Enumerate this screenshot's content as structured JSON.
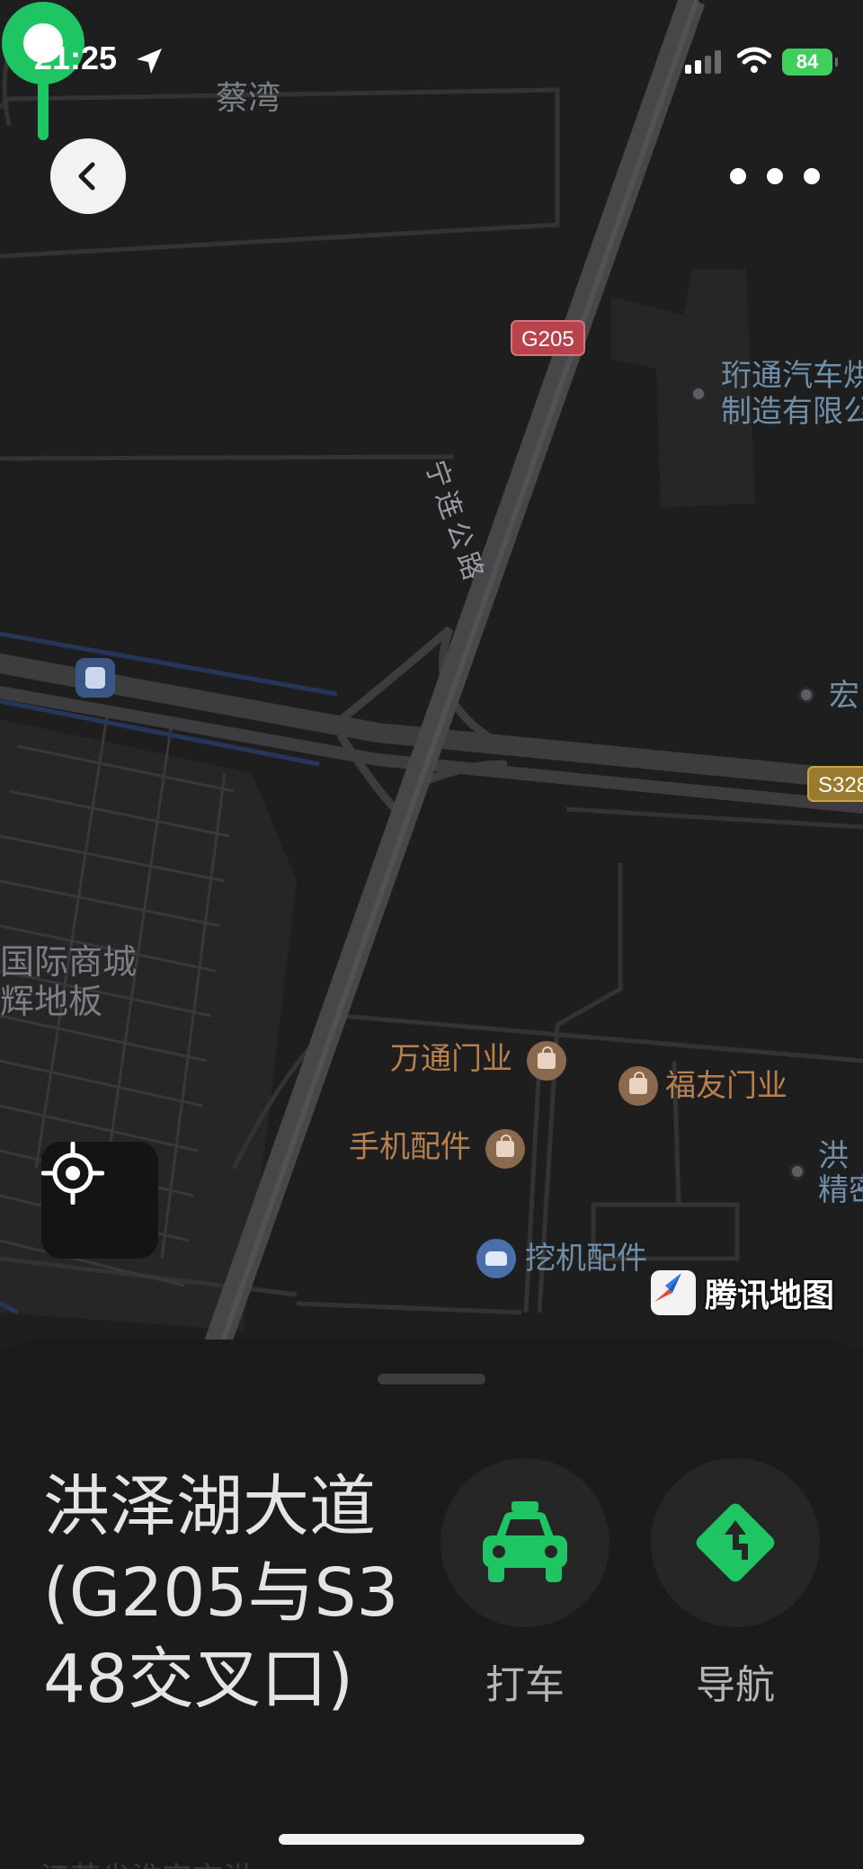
{
  "status_bar": {
    "time": "21:25",
    "battery": "84"
  },
  "map": {
    "labels": {
      "village": "蔡湾",
      "company_line1": "珩通汽车烘",
      "company_line2": "制造有限公",
      "road_name": "宁连公路",
      "right_poi": "宏",
      "mall_line1": "国际商城",
      "mall_line2": "辉地板",
      "shop1": "万通门业",
      "shop2": "福友门业",
      "shop3": "手机配件",
      "service": "挖机配件",
      "right_poi2_line1": "洪",
      "right_poi2_line2": "精密"
    },
    "shields": {
      "g205": "G205",
      "s328": "S328"
    },
    "brand": "腾讯地图"
  },
  "sheet": {
    "place_name": "洪泽湖大道(G205与S348交叉口)",
    "actions": {
      "taxi_label": "打车",
      "navigate_label": "导航"
    },
    "address_partial": "江苏省淮安市洪"
  },
  "colors": {
    "accent_green": "#1fc463",
    "map_bg": "#1e1e1f",
    "sheet_bg": "#1b1b1c"
  },
  "icons": [
    "location-arrow-icon",
    "signal-icon",
    "wifi-icon",
    "battery-icon",
    "back-icon",
    "more-icon",
    "locate-icon",
    "taxi-icon",
    "navigation-icon",
    "map-pin-icon"
  ]
}
